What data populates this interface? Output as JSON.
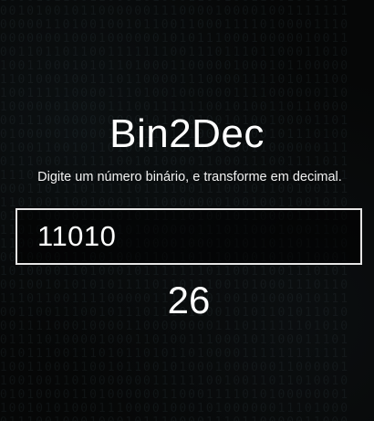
{
  "app": {
    "title": "Bin2Dec",
    "subtitle": "Digite um número binário, e transforme em decimal."
  },
  "input": {
    "value": "11010",
    "placeholder": ""
  },
  "result": {
    "value": "26"
  }
}
